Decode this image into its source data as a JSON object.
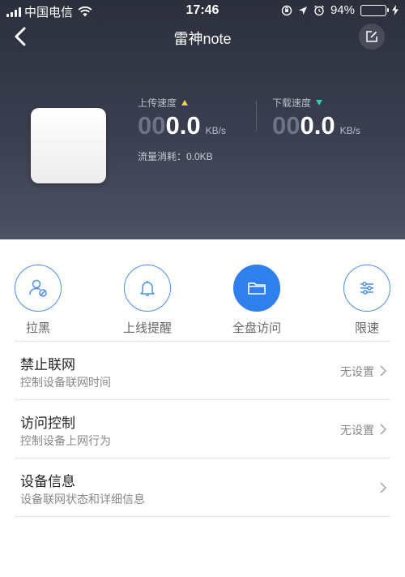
{
  "status_bar": {
    "carrier": "中国电信",
    "time": "17:46",
    "battery": "94%",
    "battery_level": 0.94
  },
  "nav": {
    "title": "雷神note",
    "back_icon": "chevron-left-icon",
    "edit_icon": "edit-icon"
  },
  "speeds": {
    "upload": {
      "label": "上传速度",
      "leading": "00",
      "value": "0.0",
      "unit": "KB/s"
    },
    "download": {
      "label": "下载速度",
      "leading": "00",
      "value": "0.0",
      "unit": "KB/s"
    },
    "traffic": "流量消耗：0.0KB"
  },
  "actions": [
    {
      "label": "拉黑",
      "icon": "block-user-icon"
    },
    {
      "label": "上线提醒",
      "icon": "bell-icon"
    },
    {
      "label": "全盘访问",
      "icon": "folder-icon",
      "active": true
    },
    {
      "label": "限速",
      "icon": "sliders-icon"
    }
  ],
  "list": [
    {
      "title": "禁止联网",
      "subtitle": "控制设备联网时间",
      "value": "无设置"
    },
    {
      "title": "访问控制",
      "subtitle": "控制设备上网行为",
      "value": "无设置"
    },
    {
      "title": "设备信息",
      "subtitle": "设备联网状态和详细信息",
      "value": ""
    }
  ],
  "colors": {
    "accent": "#2f80ed",
    "upload_arrow": "#e8d83a",
    "download_arrow": "#2ad3b2",
    "battery": "#4cd964"
  }
}
